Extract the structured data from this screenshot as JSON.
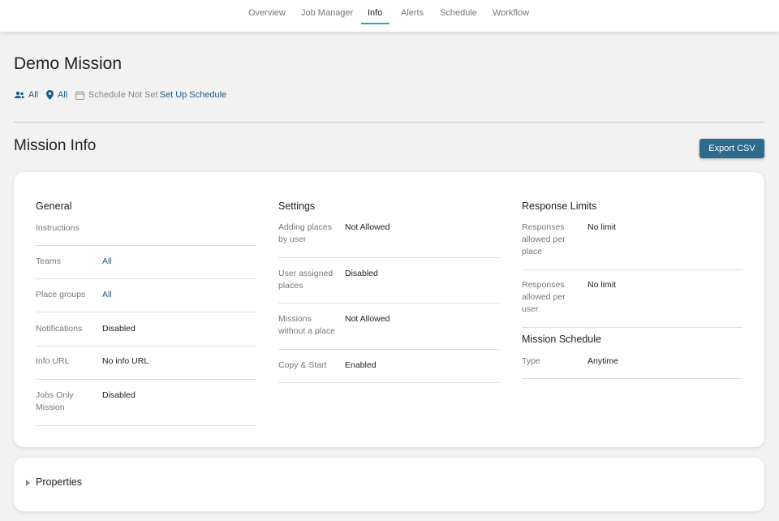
{
  "nav": {
    "tabs": [
      "Overview",
      "Job Manager",
      "Info",
      "Alerts",
      "Schedule",
      "Workflow"
    ],
    "active_tab": "Info"
  },
  "page": {
    "title": "Demo Mission",
    "teams_filter": "All",
    "places_filter": "All",
    "schedule_status": "Schedule Not Set",
    "schedule_link": "Set Up Schedule"
  },
  "mission_info": {
    "title": "Mission Info",
    "export_label": "Export CSV"
  },
  "general": {
    "heading": "General",
    "rows": [
      {
        "label": "Instructions",
        "value": ""
      },
      {
        "label": "Teams",
        "value": "All"
      },
      {
        "label": "Place groups",
        "value": "All"
      },
      {
        "label": "Notifications",
        "value": "Disabled"
      },
      {
        "label": "Info URL",
        "value": "No info URL"
      },
      {
        "label": "Jobs Only Mission",
        "value": "Disabled"
      }
    ]
  },
  "settings": {
    "heading": "Settings",
    "rows": [
      {
        "label": "Adding places by user",
        "value": "Not Allowed"
      },
      {
        "label": "User assigned places",
        "value": "Disabled"
      },
      {
        "label": "Missions without a place",
        "value": "Not Allowed"
      },
      {
        "label": "Copy & Start",
        "value": "Enabled"
      }
    ]
  },
  "response_limits": {
    "heading": "Response Limits",
    "rows": [
      {
        "label": "Responses allowed per place",
        "value": "No limit"
      },
      {
        "label": "Responses allowed per user",
        "value": "No limit"
      }
    ]
  },
  "mission_schedule": {
    "heading": "Mission Schedule",
    "rows": [
      {
        "label": "Type",
        "value": "Anytime"
      }
    ]
  },
  "properties": {
    "label": "Properties"
  },
  "colors": {
    "accent": "#2aa8b8",
    "link": "#1e5a80",
    "button": "#2d6a8e"
  }
}
